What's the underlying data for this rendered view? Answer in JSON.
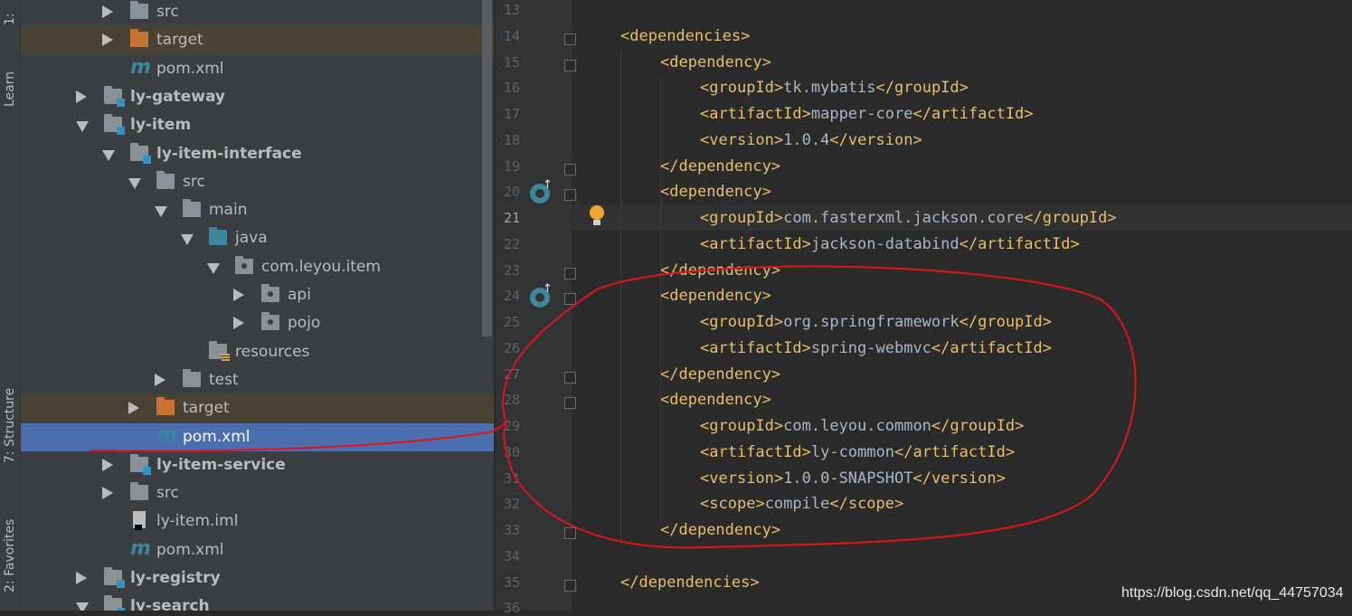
{
  "sidebar_tabs": {
    "project": "1:",
    "learn": "Learn",
    "structure": "7: Structure",
    "favorites": "2: Favorites"
  },
  "tree": [
    {
      "label": "src",
      "depth": 2,
      "arrow": "right",
      "icon": "folder",
      "bold": false
    },
    {
      "label": "target",
      "depth": 2,
      "arrow": "right",
      "icon": "folder-orange",
      "bold": false
    },
    {
      "label": "pom.xml",
      "depth": 2,
      "arrow": "none",
      "icon": "maven",
      "bold": false
    },
    {
      "label": "ly-gateway",
      "depth": 1,
      "arrow": "right",
      "icon": "module",
      "bold": true
    },
    {
      "label": "ly-item",
      "depth": 1,
      "arrow": "down",
      "icon": "module",
      "bold": true
    },
    {
      "label": "ly-item-interface",
      "depth": 2,
      "arrow": "down",
      "icon": "module",
      "bold": true
    },
    {
      "label": "src",
      "depth": 3,
      "arrow": "down",
      "icon": "folder",
      "bold": false
    },
    {
      "label": "main",
      "depth": 4,
      "arrow": "down",
      "icon": "folder",
      "bold": false
    },
    {
      "label": "java",
      "depth": 5,
      "arrow": "down",
      "icon": "folder-blue",
      "bold": false
    },
    {
      "label": "com.leyou.item",
      "depth": 6,
      "arrow": "down",
      "icon": "package",
      "bold": false
    },
    {
      "label": "api",
      "depth": 7,
      "arrow": "right",
      "icon": "package",
      "bold": false
    },
    {
      "label": "pojo",
      "depth": 7,
      "arrow": "right",
      "icon": "package",
      "bold": false
    },
    {
      "label": "resources",
      "depth": 5,
      "arrow": "none",
      "icon": "resources",
      "bold": false
    },
    {
      "label": "test",
      "depth": 4,
      "arrow": "right",
      "icon": "folder",
      "bold": false
    },
    {
      "label": "target",
      "depth": 3,
      "arrow": "right",
      "icon": "folder-orange",
      "bold": false
    },
    {
      "label": "pom.xml",
      "depth": 3,
      "arrow": "none",
      "icon": "maven",
      "bold": false,
      "selected": true
    },
    {
      "label": "ly-item-service",
      "depth": 2,
      "arrow": "right",
      "icon": "module",
      "bold": true
    },
    {
      "label": "src",
      "depth": 2,
      "arrow": "right",
      "icon": "folder",
      "bold": false
    },
    {
      "label": "ly-item.iml",
      "depth": 2,
      "arrow": "none",
      "icon": "iml",
      "bold": false
    },
    {
      "label": "pom.xml",
      "depth": 2,
      "arrow": "none",
      "icon": "maven",
      "bold": false
    },
    {
      "label": "ly-registry",
      "depth": 1,
      "arrow": "right",
      "icon": "module",
      "bold": true
    },
    {
      "label": "ly-search",
      "depth": 1,
      "arrow": "down",
      "icon": "module",
      "bold": true
    }
  ],
  "editor": {
    "current_line": 21,
    "lines": [
      {
        "n": "13",
        "indent": 0,
        "tag": "",
        "text": "",
        "close": false
      },
      {
        "n": "14",
        "indent": 1,
        "tag": "dependencies",
        "text": "",
        "close": false
      },
      {
        "n": "15",
        "indent": 2,
        "tag": "dependency",
        "text": "",
        "close": false
      },
      {
        "n": "16",
        "indent": 3,
        "tag": "groupId",
        "text": "tk.mybatis",
        "close": true
      },
      {
        "n": "17",
        "indent": 3,
        "tag": "artifactId",
        "text": "mapper-core",
        "close": true
      },
      {
        "n": "18",
        "indent": 3,
        "tag": "version",
        "text": "1.0.4",
        "close": true
      },
      {
        "n": "19",
        "indent": 2,
        "tag": "/dependency",
        "text": "",
        "close": false
      },
      {
        "n": "20",
        "indent": 2,
        "tag": "dependency",
        "text": "",
        "close": false
      },
      {
        "n": "21",
        "indent": 3,
        "tag": "groupId",
        "text": "com.fasterxml.jackson.core",
        "close": true
      },
      {
        "n": "22",
        "indent": 3,
        "tag": "artifactId",
        "text": "jackson-databind",
        "close": true
      },
      {
        "n": "23",
        "indent": 2,
        "tag": "/dependency",
        "text": "",
        "close": false
      },
      {
        "n": "24",
        "indent": 2,
        "tag": "dependency",
        "text": "",
        "close": false
      },
      {
        "n": "25",
        "indent": 3,
        "tag": "groupId",
        "text": "org.springframework",
        "close": true
      },
      {
        "n": "26",
        "indent": 3,
        "tag": "artifactId",
        "text": "spring-webmvc",
        "close": true
      },
      {
        "n": "27",
        "indent": 2,
        "tag": "/dependency",
        "text": "",
        "close": false
      },
      {
        "n": "28",
        "indent": 2,
        "tag": "dependency",
        "text": "",
        "close": false
      },
      {
        "n": "29",
        "indent": 3,
        "tag": "groupId",
        "text": "com.leyou.common",
        "close": true
      },
      {
        "n": "30",
        "indent": 3,
        "tag": "artifactId",
        "text": "ly-common",
        "close": true
      },
      {
        "n": "31",
        "indent": 3,
        "tag": "version",
        "text": "1.0.0-SNAPSHOT",
        "close": true
      },
      {
        "n": "32",
        "indent": 3,
        "tag": "scope",
        "text": "compile",
        "close": true
      },
      {
        "n": "33",
        "indent": 2,
        "tag": "/dependency",
        "text": "",
        "close": false
      },
      {
        "n": "34",
        "indent": 0,
        "tag": "",
        "text": "",
        "close": false
      },
      {
        "n": "35",
        "indent": 1,
        "tag": "/dependencies",
        "text": "",
        "close": false
      },
      {
        "n": "36",
        "indent": 0,
        "tag": "",
        "text": "",
        "close": false
      }
    ],
    "fold_lines": [
      "14",
      "15",
      "19",
      "20",
      "23",
      "24",
      "27",
      "28",
      "33",
      "35"
    ],
    "override_icon_lines": [
      "20",
      "24"
    ]
  },
  "watermark": "https://blog.csdn.net/qq_44757034",
  "colors": {
    "bracket": "#e8bf6a",
    "text": "#a9b7c6",
    "selection": "#4b6eaf",
    "annotation": "#e0141b"
  }
}
